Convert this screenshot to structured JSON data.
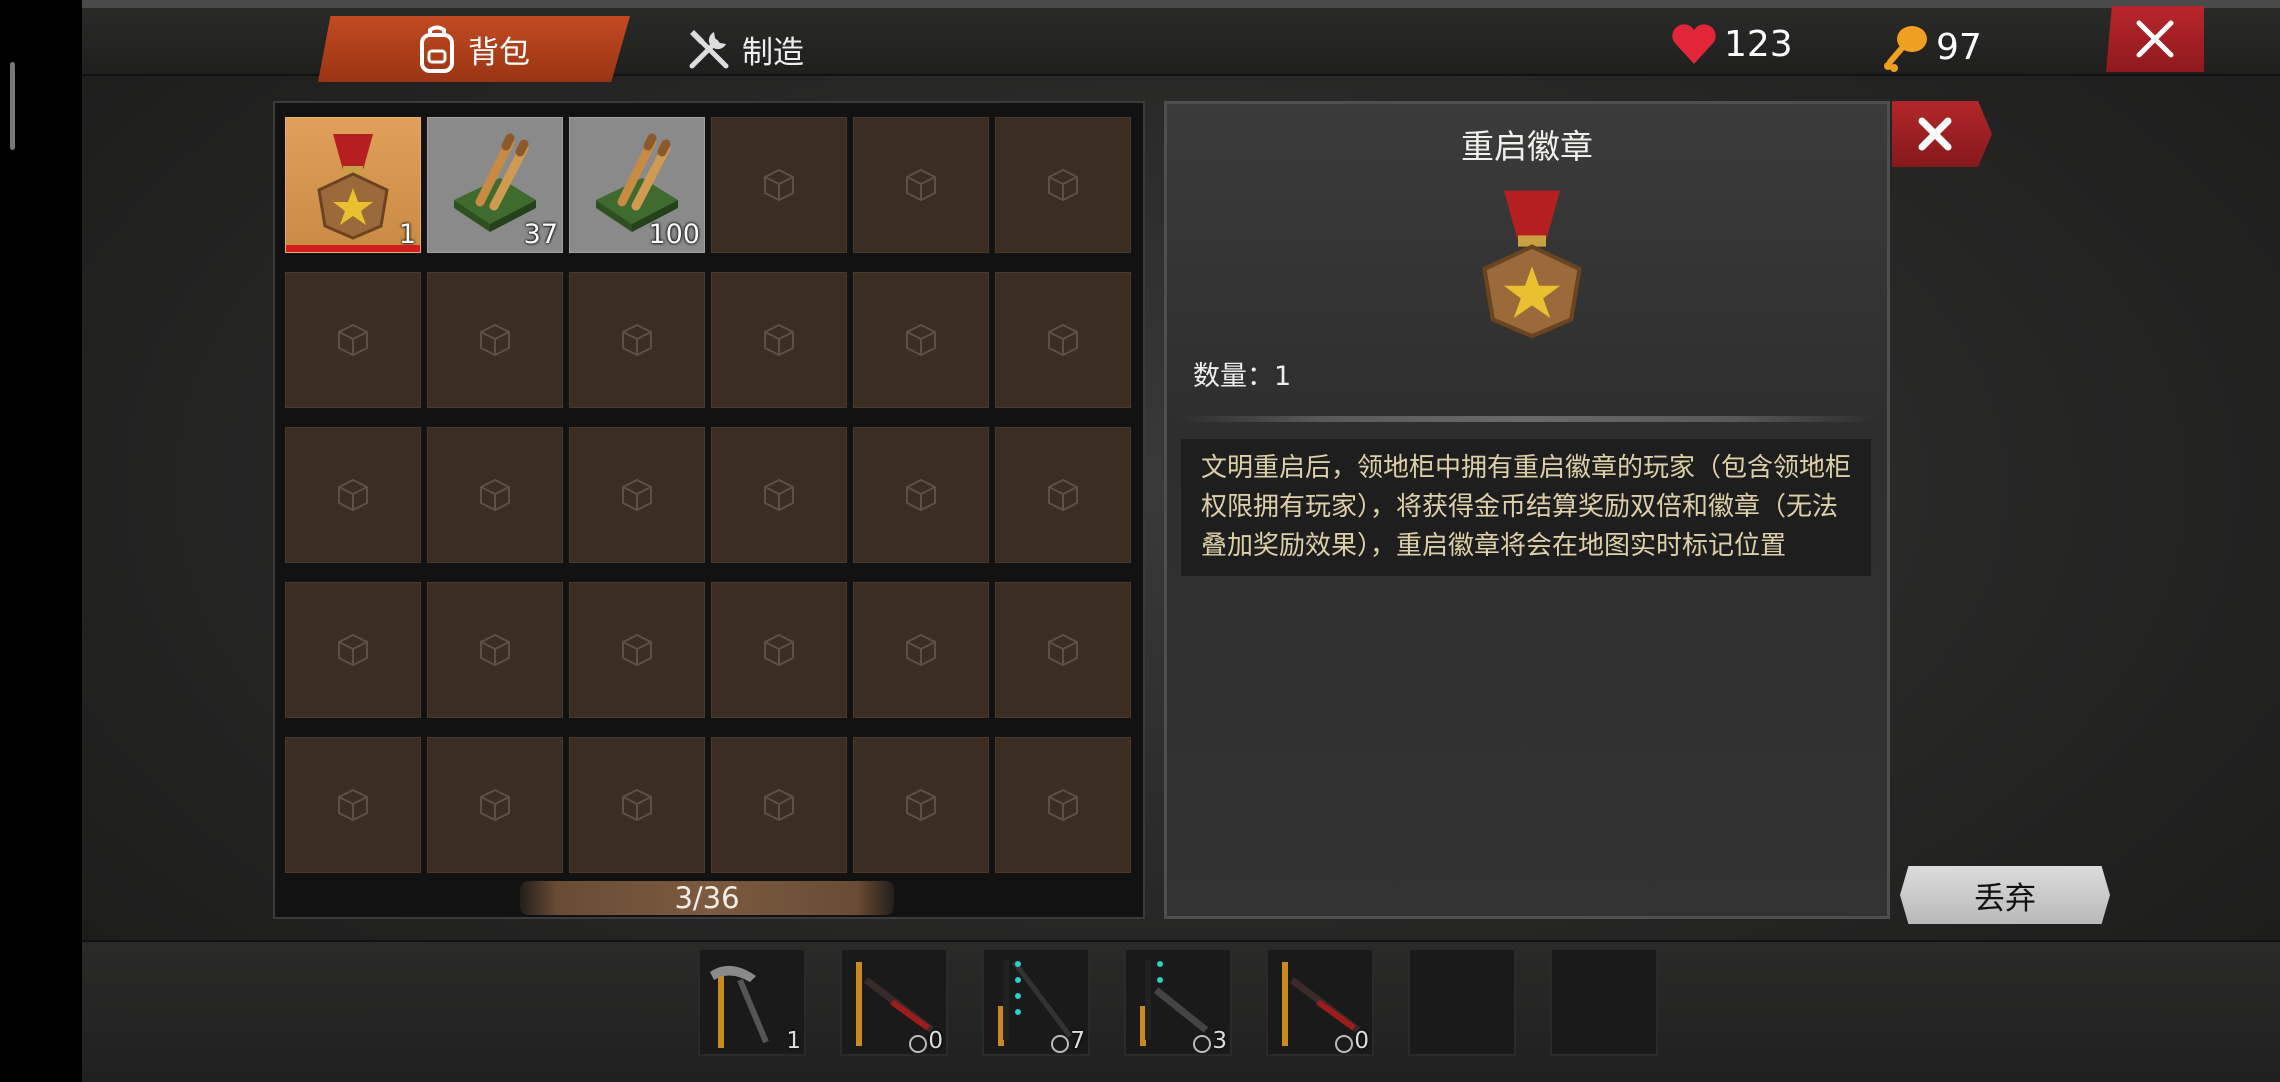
{
  "top_bar": {
    "tabs": [
      {
        "label": "背包",
        "icon": "backpack-icon",
        "active": true
      },
      {
        "label": "制造",
        "icon": "tools-icon",
        "active": false
      }
    ],
    "health": {
      "icon": "heart-icon",
      "value": "123"
    },
    "food": {
      "icon": "drumstick-icon",
      "value": "97"
    },
    "close_icon": "close-icon"
  },
  "inventory": {
    "slots": [
      {
        "item": "medal",
        "count": "1",
        "selected": true
      },
      {
        "item": "ammo",
        "count": "37"
      },
      {
        "item": "ammo",
        "count": "100"
      }
    ],
    "total_slots": 30,
    "capacity": "3/36"
  },
  "detail": {
    "title": "重启徽章",
    "icon": "medal-icon",
    "quantity": "数量：1",
    "description": "文明重启后，领地柜中拥有重启徽章的玩家（包含领地柜权限拥有玩家），将获得金币结算奖励双倍和徽章（无法叠加奖励效果），重启徽章将会在地图实时标记位置",
    "discard_label": "丢弃"
  },
  "hotbar": [
    {
      "item": "pickaxe",
      "count": "1"
    },
    {
      "item": "rifle",
      "count": "0",
      "ammo_icon": true
    },
    {
      "item": "bow",
      "count": "7",
      "ammo_icon": true
    },
    {
      "item": "shotgun",
      "count": "3",
      "ammo_icon": true
    },
    {
      "item": "rifle",
      "count": "0",
      "ammo_icon": true
    },
    {
      "item": null,
      "count": ""
    },
    {
      "item": null,
      "count": ""
    }
  ],
  "colors": {
    "tab_active": "#b3411b",
    "close_red": "#a62025",
    "slot_empty": "#3b2d22",
    "slot_selected": "#d39246",
    "description_text": "#ddd0a8"
  }
}
